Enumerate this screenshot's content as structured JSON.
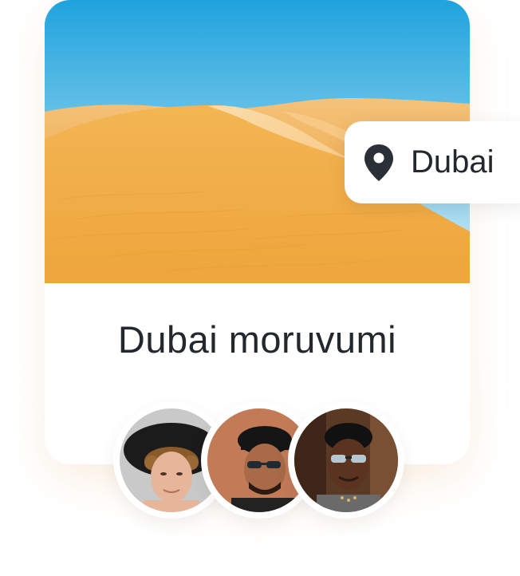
{
  "card": {
    "image": "desert-dunes-photo",
    "title": "Dubai moruvumi"
  },
  "location": {
    "icon": "location-pin-icon",
    "label": "Dubai"
  },
  "avatars": [
    {
      "name": "avatar-1",
      "style": "curly hair, black hat"
    },
    {
      "name": "avatar-2",
      "style": "cap, sunglasses"
    },
    {
      "name": "avatar-3",
      "style": "sunglasses, earrings"
    }
  ],
  "colors": {
    "text": "#23272e",
    "sky_top": "#22a6de",
    "sand": "#f1ae3f",
    "card_bg": "#ffffff"
  }
}
